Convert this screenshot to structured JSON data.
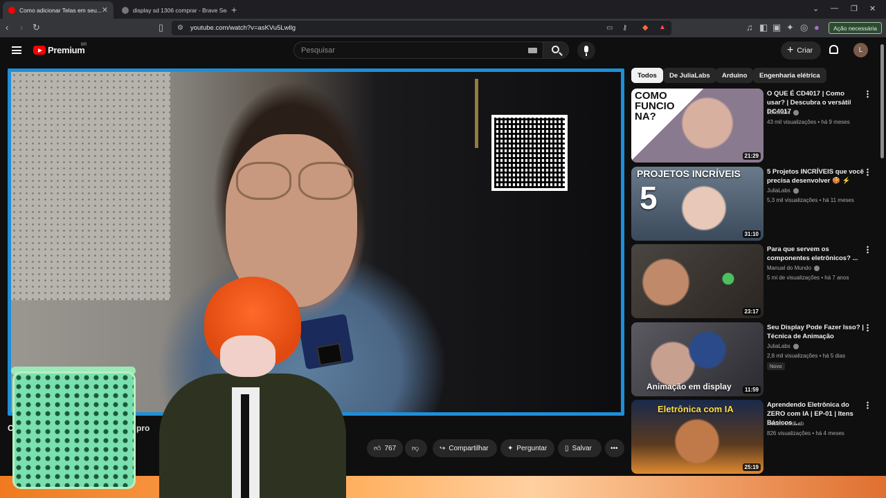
{
  "browser": {
    "tabs": [
      {
        "title": "Como adicionar Telas em seu...",
        "active": true
      },
      {
        "title": "display sd 1306 comprar - Brave Sear...",
        "active": false
      }
    ],
    "new_tab": "+",
    "url": "youtube.com/watch?v=asKVu5Lwllg",
    "action_button": "Ação necessária"
  },
  "header": {
    "logo_text": "Premium",
    "region": "BR",
    "search_placeholder": "Pesquisar",
    "create_label": "Criar",
    "avatar_letter": "L"
  },
  "video": {
    "title_fragment_start": "C",
    "title_fragment_end": "pro",
    "actions": {
      "likes": "767",
      "share": "Compartilhar",
      "ask": "Perguntar",
      "save": "Salvar"
    }
  },
  "sidebar": {
    "chips": [
      "Todos",
      "De JuliaLabs",
      "Arduino",
      "Engenharia elétrica"
    ],
    "recommendations": [
      {
        "title": "O QUE É CD4017 | Como usar? | Descubra o versátil DC4017 ...",
        "channel": "JuliaLabs",
        "views": "43 mil visualizações",
        "age": "há 9 meses",
        "duration": "21:29",
        "thumb_text": "COMO FUNCIO NA?",
        "thumb_color": "#8a7a90"
      },
      {
        "title": "5 Projetos INCRÍVEIS que você precisa desenvolver 🍪 ⚡",
        "channel": "JuliaLabs",
        "views": "5,3 mil visualizações",
        "age": "há 11 meses",
        "duration": "31:10",
        "thumb_text": "PROJETOS INCRÍVEIS",
        "thumb_color": "#5a6a7a"
      },
      {
        "title": "Para que servem os componentes eletrônicos? ...",
        "channel": "Manual do Mundo",
        "views": "5 mi de visualizações",
        "age": "há 7 anos",
        "duration": "23:17",
        "thumb_text": "",
        "thumb_color": "#3a3530"
      },
      {
        "title": "Seu Display Pode Fazer Isso? | Técnica de Animação",
        "channel": "JuliaLabs",
        "views": "2,8 mil visualizações",
        "age": "há 5 dias",
        "badge": "Novo",
        "duration": "11:59",
        "thumb_text": "Animação em display",
        "thumb_color": "#4a4a50"
      },
      {
        "title": "Aprendendo Eletrônica do ZERO com IA | EP-01 | Itens Básicos ...",
        "channel": "NossoNerdLab",
        "views": "826 visualizações",
        "age": "há 4 meses",
        "duration": "25:19",
        "thumb_text": "Eletrônica com IA",
        "thumb_color": "#5a3a20"
      }
    ]
  }
}
